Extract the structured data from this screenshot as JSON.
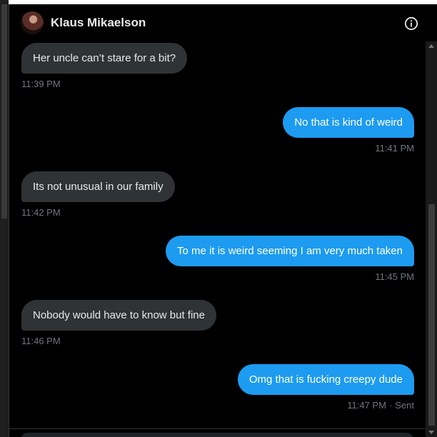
{
  "header": {
    "contact_name": "Klaus Mikaelson",
    "avatar_icon": "avatar",
    "info_icon": "info-icon"
  },
  "colors": {
    "incoming_bubble": "#2f3336",
    "outgoing_bubble": "#1d9bf0",
    "background": "#000000",
    "timestamp": "#71767b"
  },
  "messages": [
    {
      "direction": "in",
      "text": "Her uncle can’t stare for a bit?",
      "time": "11:39 PM"
    },
    {
      "direction": "out",
      "text": "No that is kind of weird",
      "time": "11:41 PM"
    },
    {
      "direction": "in",
      "text": "Its not unusual in our family",
      "time": "11:42 PM"
    },
    {
      "direction": "out",
      "text": "To me it is weird seeming I am very much taken",
      "time": "11:45 PM"
    },
    {
      "direction": "in",
      "text": "Nobody would have to know but fine",
      "time": "11:46 PM"
    },
    {
      "direction": "out",
      "text": "Omg that is fucking creepy dude",
      "time": "11:47 PM",
      "status": "Sent"
    }
  ]
}
